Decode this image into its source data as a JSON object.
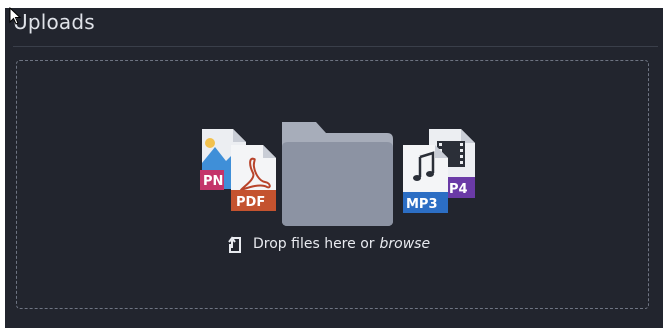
{
  "panel": {
    "title": "Uploads"
  },
  "dropzone": {
    "prompt": "Drop files here or",
    "browse_label": "browse",
    "upload_icon": "upload-icon",
    "center_icon": "folder-icon",
    "file_badges": [
      "PN",
      "PDF",
      "MP3",
      "P4"
    ]
  },
  "colors": {
    "background": "#22252e",
    "dashed_border": "#6e7482",
    "folder": "#8c93a3",
    "pdf_badge": "#c4532f",
    "png_badge": "#c4346a",
    "mp3_badge": "#2c6ec4",
    "mp4_badge": "#6a3aa6"
  }
}
